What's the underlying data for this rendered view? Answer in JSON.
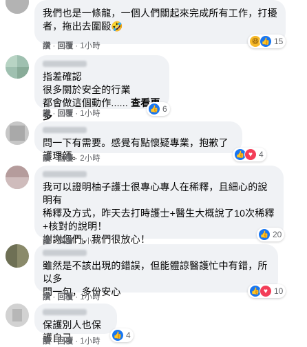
{
  "comments": [
    {
      "text": "我們也是一條龍，一個人們關起來完成所有工作，打擾\n者，拖出去圍毆🤣",
      "see_more": "",
      "reaction_count": "15",
      "reactions": [
        "haha-icon",
        "like-icon"
      ],
      "actions": {
        "like": "讚",
        "reply": "回覆",
        "time": "1小時"
      }
    },
    {
      "text": "指差確認\n很多關於安全的行業\n都會做這個動作......",
      "see_more": "查看更多",
      "reaction_count": "6",
      "reactions": [
        "like-icon"
      ],
      "actions": {
        "like": "讚",
        "reply": "回覆",
        "time": "1小時"
      }
    },
    {
      "text": "問一下有需要。感覺有點懷疑專業，抱歉了護理師。",
      "see_more": "",
      "reaction_count": "4",
      "reactions": [
        "like-icon",
        "love-icon"
      ],
      "actions": {
        "like": "讚",
        "reply": "回覆",
        "time": "2小時"
      }
    },
    {
      "text": "我可以證明柚子護士很專心專人在稀釋，且細心的說明有\n稀釋及方式，昨天去打時護士+醫生大概說了10次稀釋\n+核對的說明！\n謝謝您們，我們很放心！",
      "see_more": "",
      "reaction_count": "20",
      "reactions": [
        "like-icon"
      ],
      "actions": {
        "like": "讚",
        "reply": "回覆",
        "time": "1小時"
      }
    },
    {
      "text": "雖然是不該出現的錯誤，但能體諒醫護忙中有錯，所以多\n問一句，多份安心",
      "see_more": "",
      "reaction_count": "10",
      "reactions": [
        "like-icon",
        "love-icon"
      ],
      "actions": {
        "like": "讚",
        "reply": "回覆",
        "time": "1小時"
      }
    },
    {
      "text": "保護別人也保護自己",
      "see_more": "",
      "reaction_count": "4",
      "reactions": [
        "like-icon"
      ],
      "actions": {
        "like": "讚",
        "reply": "回覆",
        "time": "1小時"
      }
    }
  ],
  "separator": "·"
}
